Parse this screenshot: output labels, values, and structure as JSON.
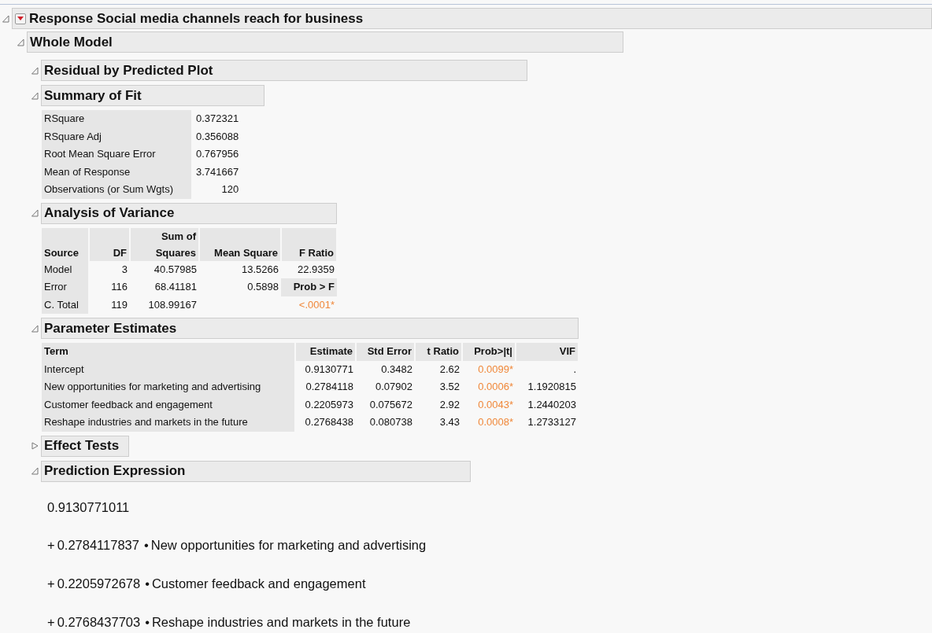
{
  "report": {
    "title": "Response Social media channels reach for business",
    "expanded": true
  },
  "whole_model": {
    "title": "Whole Model",
    "expanded": true
  },
  "sections": [
    {
      "kind": "plot",
      "title": "Residual by Predicted Plot",
      "expanded": true
    },
    {
      "kind": "summary",
      "title": "Summary of Fit",
      "expanded": true,
      "rows": [
        {
          "label": "RSquare",
          "value": "0.372321"
        },
        {
          "label": "RSquare Adj",
          "value": "0.356088"
        },
        {
          "label": "Root Mean Square Error",
          "value": "0.767956"
        },
        {
          "label": "Mean of Response",
          "value": "3.741667"
        },
        {
          "label": "Observations (or Sum Wgts)",
          "value": "120"
        }
      ]
    },
    {
      "kind": "anova",
      "title": "Analysis of Variance",
      "expanded": true,
      "columns": [
        [
          "Source"
        ],
        [
          "DF"
        ],
        [
          "Sum of",
          "Squares"
        ],
        [
          "Mean Square"
        ],
        [
          "F Ratio"
        ]
      ],
      "rows": [
        {
          "source": "Model",
          "df": "3",
          "ss": "40.57985",
          "ms": "13.5266",
          "last": {
            "kind": "value",
            "text": "22.9359"
          }
        },
        {
          "source": "Error",
          "df": "116",
          "ss": "68.41181",
          "ms": "0.5898",
          "last": {
            "kind": "label",
            "text": "Prob > F"
          }
        },
        {
          "source": "C. Total",
          "df": "119",
          "ss": "108.99167",
          "last": {
            "kind": "value",
            "text": "<.0001*",
            "significant": true
          }
        }
      ]
    },
    {
      "kind": "estimates",
      "title": "Parameter Estimates",
      "expanded": true,
      "columns": [
        "Term",
        "Estimate",
        "Std Error",
        "t Ratio",
        "Prob>|t|",
        "VIF"
      ],
      "rows": [
        {
          "term": "Intercept",
          "estimate": "0.9130771",
          "std_error": "0.3482",
          "t_ratio": "2.62",
          "p_value": "0.0099*",
          "significant": true,
          "vif": "."
        },
        {
          "term": "New opportunities for marketing and advertising",
          "estimate": "0.2784118",
          "std_error": "0.07902",
          "t_ratio": "3.52",
          "p_value": "0.0006*",
          "significant": true,
          "vif": "1.1920815"
        },
        {
          "term": "Customer feedback and engagement",
          "estimate": "0.2205973",
          "std_error": "0.075672",
          "t_ratio": "2.92",
          "p_value": "0.0043*",
          "significant": true,
          "vif": "1.2440203"
        },
        {
          "term": "Reshape industries and markets in the future",
          "estimate": "0.2768438",
          "std_error": "0.080738",
          "t_ratio": "3.43",
          "p_value": "0.0008*",
          "significant": true,
          "vif": "1.2733127"
        }
      ]
    },
    {
      "kind": "effects",
      "title": "Effect Tests",
      "expanded": false
    },
    {
      "kind": "expression",
      "title": "Prediction Expression",
      "expanded": true,
      "intercept": "0.9130771011",
      "terms": [
        {
          "sign": "+",
          "coef": "0.2784117837",
          "dot": "•",
          "name": "New opportunities for marketing and advertising"
        },
        {
          "sign": "+",
          "coef": "0.2205972678",
          "dot": "•",
          "name": "Customer feedback and engagement"
        },
        {
          "sign": "+",
          "coef": "0.2768437703",
          "dot": "•",
          "name": "Reshape industries and markets in the future"
        }
      ]
    }
  ]
}
